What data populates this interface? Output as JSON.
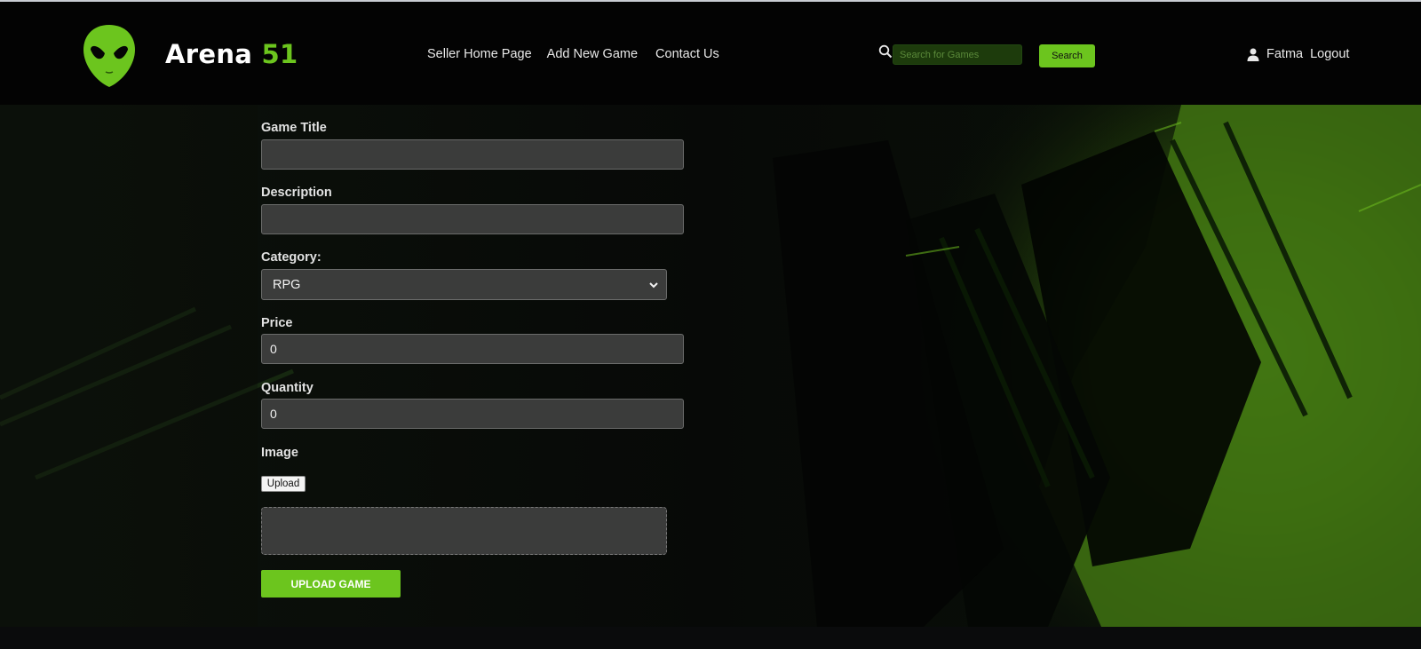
{
  "brand": {
    "name": "Arena",
    "number": "51",
    "accent_color": "#6cc51e"
  },
  "nav": [
    {
      "label": "Seller Home Page"
    },
    {
      "label": "Add New Game"
    },
    {
      "label": "Contact Us"
    }
  ],
  "search": {
    "placeholder": "Search for Games",
    "value": "",
    "button_label": "Search",
    "icon": "search-icon"
  },
  "user": {
    "icon": "user-icon",
    "name": "Fatma",
    "logout_label": "Logout"
  },
  "form": {
    "title_label": "Game Title",
    "title_value": "",
    "description_label": "Description",
    "description_value": "",
    "category_label": "Category:",
    "category_value": "RPG",
    "price_label": "Price",
    "price_value": "0",
    "quantity_label": "Quantity",
    "quantity_value": "0",
    "image_label": "Image",
    "upload_label": "Upload",
    "submit_label": "UPLOAD GAME"
  },
  "colors": {
    "navbar": "#030303",
    "field_bg": "#3b3c3b",
    "button_green": "#6cc51e"
  }
}
